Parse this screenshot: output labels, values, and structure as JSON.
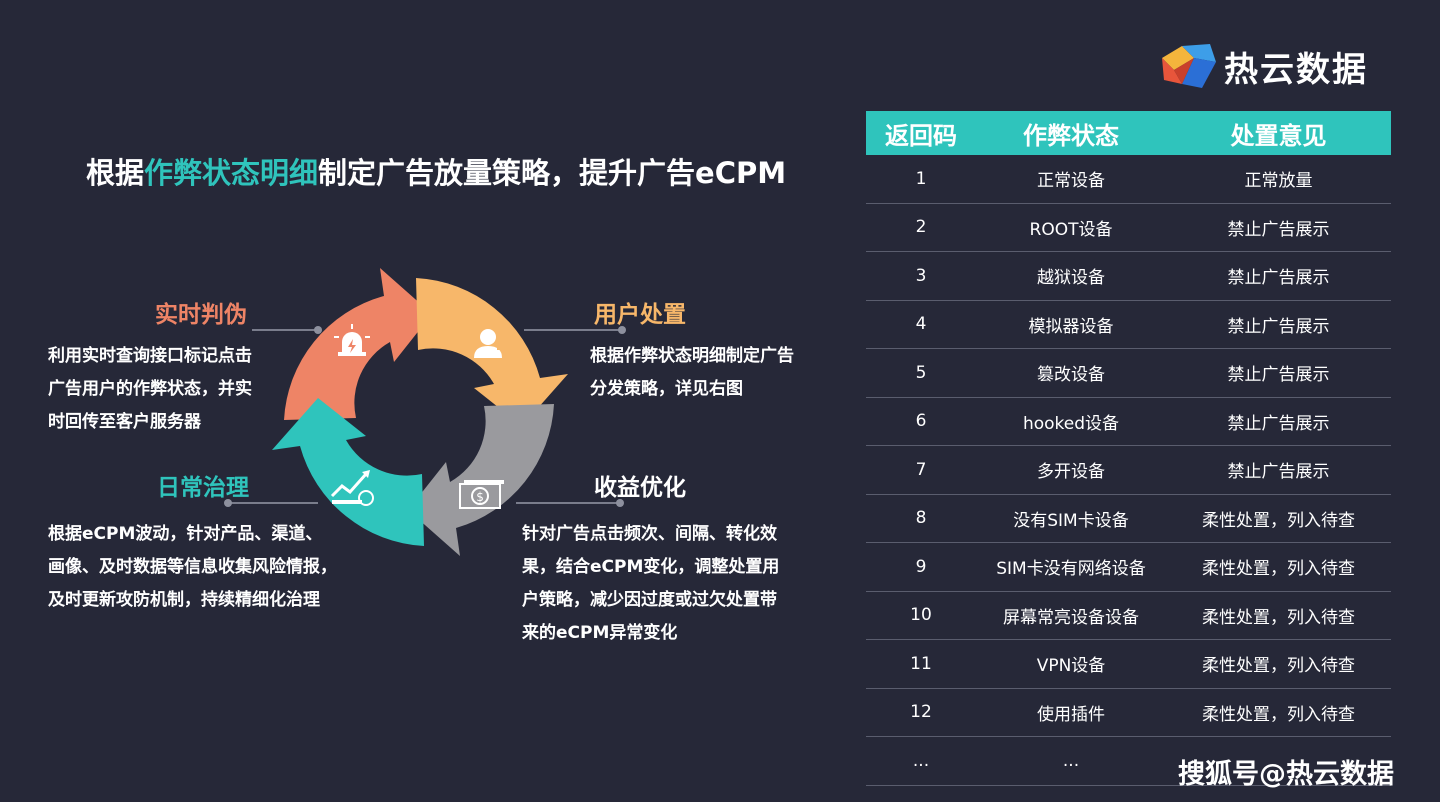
{
  "brand": {
    "name": "热云数据",
    "colors": [
      "#e8553b",
      "#3d9ee8",
      "#2b6fd6",
      "#f4b53c"
    ]
  },
  "headline": {
    "prefix": "根据",
    "highlight": "作弊状态明细",
    "suffix": "制定广告放量策略，提升广告eCPM"
  },
  "colors": {
    "background": "#262838",
    "accent": "#2fc4bc",
    "salmon": "#ee8466",
    "orange": "#f7b76a",
    "gray": "#9a9a9e"
  },
  "cycle": {
    "segments": [
      {
        "name": "实时判伪",
        "color": "#ee8466",
        "icon": "alarm-icon"
      },
      {
        "name": "用户处置",
        "color": "#f7b76a",
        "icon": "user-icon"
      },
      {
        "name": "收益优化",
        "color": "#9a9a9e",
        "icon": "dollar-bill-icon"
      },
      {
        "name": "日常治理",
        "color": "#2fc4bc",
        "icon": "trend-chart-icon"
      }
    ]
  },
  "sections": {
    "realtime": {
      "title": "实时判伪",
      "lines": [
        "利用实时查询接口标记点击",
        "广告用户的作弊状态，并实",
        "时回传至客户服务器"
      ]
    },
    "user": {
      "title": "用户处置",
      "lines": [
        "根据作弊状态明细制定广告",
        "分发策略，详见右图"
      ]
    },
    "daily": {
      "title": "日常治理",
      "lines": [
        "根据eCPM波动，针对产品、渠道、",
        "画像、及时数据等信息收集风险情报，",
        "及时更新攻防机制，持续精细化治理"
      ]
    },
    "revenue": {
      "title": "收益优化",
      "lines": [
        "针对广告点击频次、间隔、转化效",
        "果，结合eCPM变化，调整处置用",
        "户策略，减少因过度或过欠处置带",
        "来的eCPM异常变化"
      ]
    }
  },
  "table": {
    "headers": [
      "返回码",
      "作弊状态",
      "处置意见"
    ],
    "rows": [
      [
        "1",
        "正常设备",
        "正常放量"
      ],
      [
        "2",
        "ROOT设备",
        "禁止广告展示"
      ],
      [
        "3",
        "越狱设备",
        "禁止广告展示"
      ],
      [
        "4",
        "模拟器设备",
        "禁止广告展示"
      ],
      [
        "5",
        "篡改设备",
        "禁止广告展示"
      ],
      [
        "6",
        "hooked设备",
        "禁止广告展示"
      ],
      [
        "7",
        "多开设备",
        "禁止广告展示"
      ],
      [
        "8",
        "没有SIM卡设备",
        "柔性处置，列入待查"
      ],
      [
        "9",
        "SIM卡没有网络设备",
        "柔性处置，列入待查"
      ],
      [
        "10",
        "屏幕常亮设备设备",
        "柔性处置，列入待查"
      ],
      [
        "11",
        "VPN设备",
        "柔性处置，列入待查"
      ],
      [
        "12",
        "使用插件",
        "柔性处置，列入待查"
      ],
      [
        "...",
        "...",
        ""
      ]
    ]
  },
  "watermark": "搜狐号@热云数据"
}
